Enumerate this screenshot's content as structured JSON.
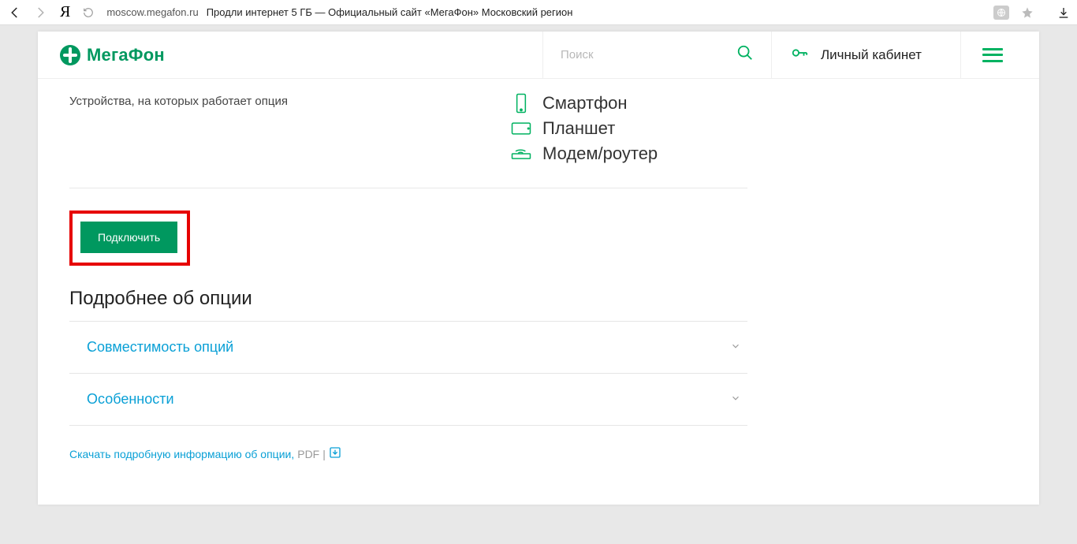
{
  "browser": {
    "domain": "moscow.megafon.ru",
    "page_title": "Продли интернет 5 ГБ — Официальный сайт «МегаФон» Московский регион"
  },
  "header": {
    "brand": "МегаФон",
    "search_placeholder": "Поиск",
    "account_label": "Личный кабинет"
  },
  "devices": {
    "label": "Устройства, на которых работает опция",
    "items": [
      {
        "icon": "smartphone-icon",
        "name": "Смартфон"
      },
      {
        "icon": "tablet-icon",
        "name": "Планшет"
      },
      {
        "icon": "router-icon",
        "name": "Модем/роутер"
      }
    ]
  },
  "cta": {
    "connect_label": "Подключить"
  },
  "details": {
    "heading": "Подробнее об опции",
    "accordion": [
      {
        "label": "Совместимость опций"
      },
      {
        "label": "Особенности"
      }
    ]
  },
  "download": {
    "text": "Скачать подробную информацию об опции,",
    "format": "PDF",
    "sep": "|"
  },
  "colors": {
    "brand_green": "#00985F",
    "link_blue": "#0aa0d6"
  }
}
